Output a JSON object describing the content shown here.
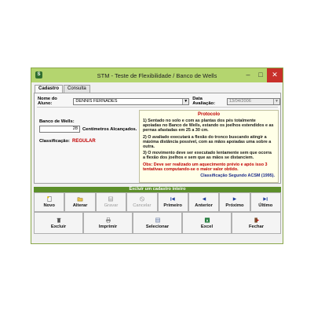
{
  "window": {
    "title": "STM - Teste de Flexibilidade / Banco de Wells",
    "minimize": "–",
    "maximize": "□",
    "close": "✕"
  },
  "tabs": [
    {
      "label": "Cadastro",
      "active": true
    },
    {
      "label": "Consulta",
      "active": false
    }
  ],
  "form": {
    "aluno_label": "Nome do Aluno:",
    "aluno_value": "DENNIS FERNADES",
    "data_label": "Data Avaliação:",
    "data_value": "13/04/2006",
    "wells_label": "Banco de Wells:",
    "wells_value": "28",
    "wells_unit": "Centímetros Alcançados.",
    "classif_label": "Classificação:",
    "classif_value": "REGULAR"
  },
  "protocol": {
    "title": "Protocolo",
    "items": [
      "1) Sentado no solo e com as plantas dos pés totalmente apoiadas no Banco de Wells, estando os joelhos estendidos e as pernas afastadas em 25 a 30 cm.",
      "2) O avaliado executará a flexão do tronco buscando atingir a máxima distância possível, com as mãos apoiadas uma sobre a outra.",
      "3) O movimento deve ser executado lentamente sem que ocorra a flexão dos joelhos e sem que as mãos se distanciem."
    ],
    "obs": "Obs: Deve ser realizado um aquecimento prévio e após isso 3 tentativas computando-se o maior valor obtido.",
    "reference": "Classificação Segundo ACSM (1995)."
  },
  "status_bar": "Excluir um cadastro inteiro",
  "toolbar1": [
    {
      "name": "novo-button",
      "icon": "new-doc-icon",
      "label": "Novo",
      "enabled": true
    },
    {
      "name": "alterar-button",
      "icon": "folder-edit-icon",
      "label": "Alterar",
      "enabled": true
    },
    {
      "name": "gravar-button",
      "icon": "save-icon",
      "label": "Gravar",
      "enabled": false
    },
    {
      "name": "cancelar-button",
      "icon": "cancel-icon",
      "label": "Cancelar",
      "enabled": false
    },
    {
      "name": "primeiro-button",
      "icon": "first-icon",
      "label": "Primeiro",
      "enabled": true
    },
    {
      "name": "anterior-button",
      "icon": "previous-icon",
      "label": "Anterior",
      "enabled": true
    },
    {
      "name": "proximo-button",
      "icon": "next-icon",
      "label": "Próximo",
      "enabled": true
    },
    {
      "name": "ultimo-button",
      "icon": "last-icon",
      "label": "Último",
      "enabled": true
    }
  ],
  "toolbar2": [
    {
      "name": "excluir-button",
      "icon": "trash-icon",
      "label": "Excluir"
    },
    {
      "name": "imprimir-button",
      "icon": "printer-icon",
      "label": "Imprimir"
    },
    {
      "name": "selecionar-button",
      "icon": "select-icon",
      "label": "Selecionar"
    },
    {
      "name": "excel-button",
      "icon": "excel-icon",
      "label": "Excel"
    },
    {
      "name": "fechar-button",
      "icon": "exit-icon",
      "label": "Fechar"
    }
  ],
  "colors": {
    "titlebar": "#b4d56f",
    "statusbar": "#5c8f2a",
    "classification": "#c00000",
    "reference": "#1a2a8a"
  }
}
